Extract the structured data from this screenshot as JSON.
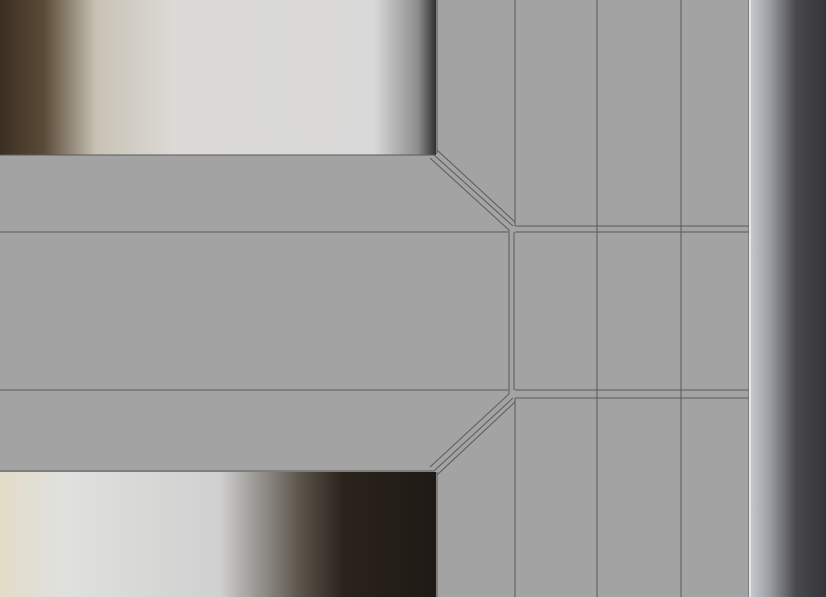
{
  "viewport": {
    "mesh_fill": "#a3a3a3",
    "wire_color": "#5a5a5a",
    "backdrop_light": "#d8d8d8",
    "backdrop_dark": "#3d3126",
    "backdrop_edge": "#2a2a2a"
  }
}
